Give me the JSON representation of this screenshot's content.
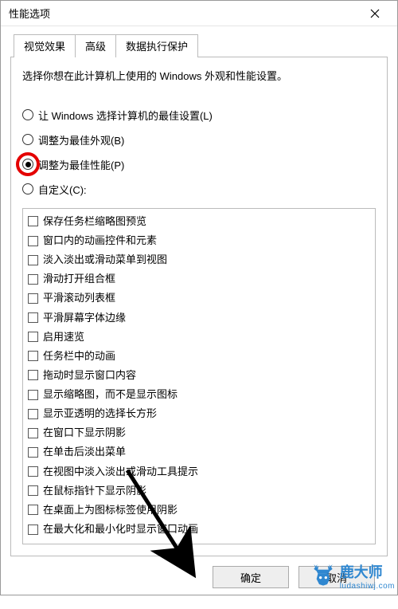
{
  "window": {
    "title": "性能选项"
  },
  "tabs": [
    {
      "label": "视觉效果",
      "active": true
    },
    {
      "label": "高级",
      "active": false
    },
    {
      "label": "数据执行保护",
      "active": false
    }
  ],
  "description": "选择你想在此计算机上使用的 Windows 外观和性能设置。",
  "radios": [
    {
      "label": "让 Windows 选择计算机的最佳设置(L)",
      "checked": false,
      "highlight": false
    },
    {
      "label": "调整为最佳外观(B)",
      "checked": false,
      "highlight": false
    },
    {
      "label": "调整为最佳性能(P)",
      "checked": true,
      "highlight": true
    },
    {
      "label": "自定义(C):",
      "checked": false,
      "highlight": false
    }
  ],
  "checks": [
    {
      "label": "保存任务栏缩略图预览"
    },
    {
      "label": "窗口内的动画控件和元素"
    },
    {
      "label": "淡入淡出或滑动菜单到视图"
    },
    {
      "label": "滑动打开组合框"
    },
    {
      "label": "平滑滚动列表框"
    },
    {
      "label": "平滑屏幕字体边缘"
    },
    {
      "label": "启用速览"
    },
    {
      "label": "任务栏中的动画"
    },
    {
      "label": "拖动时显示窗口内容"
    },
    {
      "label": "显示缩略图，而不是显示图标"
    },
    {
      "label": "显示亚透明的选择长方形"
    },
    {
      "label": "在窗口下显示阴影"
    },
    {
      "label": "在单击后淡出菜单"
    },
    {
      "label": "在视图中淡入淡出或滑动工具提示"
    },
    {
      "label": "在鼠标指针下显示阴影"
    },
    {
      "label": "在桌面上为图标标签使用阴影"
    },
    {
      "label": "在最大化和最小化时显示窗口动画"
    }
  ],
  "buttons": {
    "ok": "确定",
    "cancel": "取消"
  },
  "watermark": {
    "brand": "鹿大师",
    "url": "ludashiwj.com"
  }
}
